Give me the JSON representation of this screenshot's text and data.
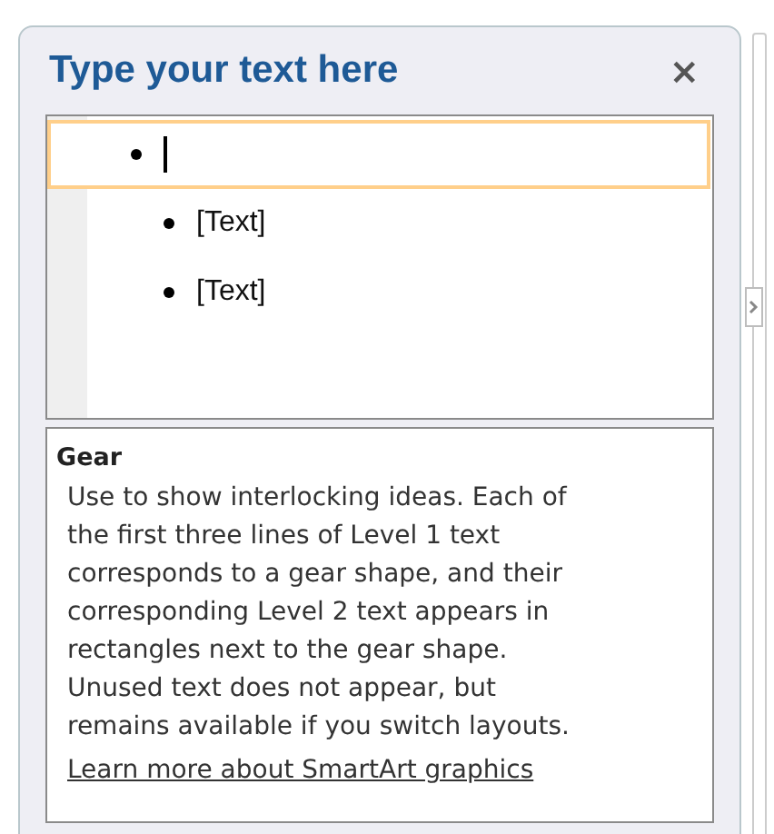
{
  "pane": {
    "title": "Type your text here",
    "close": "×"
  },
  "items": [
    {
      "selected": true,
      "caret": true
    },
    {
      "text": "[Text]",
      "selected": false,
      "caret": false
    },
    {
      "text": "[Text]",
      "selected": false,
      "caret": false
    }
  ],
  "description": {
    "heading": "Gear",
    "body": "Use to show interlocking ideas. Each of the first three lines of Level 1 text corresponds to a gear shape, and their corresponding Level 2 text appears in rectangles next to the gear shape. Unused text does not appear, but remains available if you switch layouts.",
    "link": "Learn more about SmartArt graphics"
  }
}
